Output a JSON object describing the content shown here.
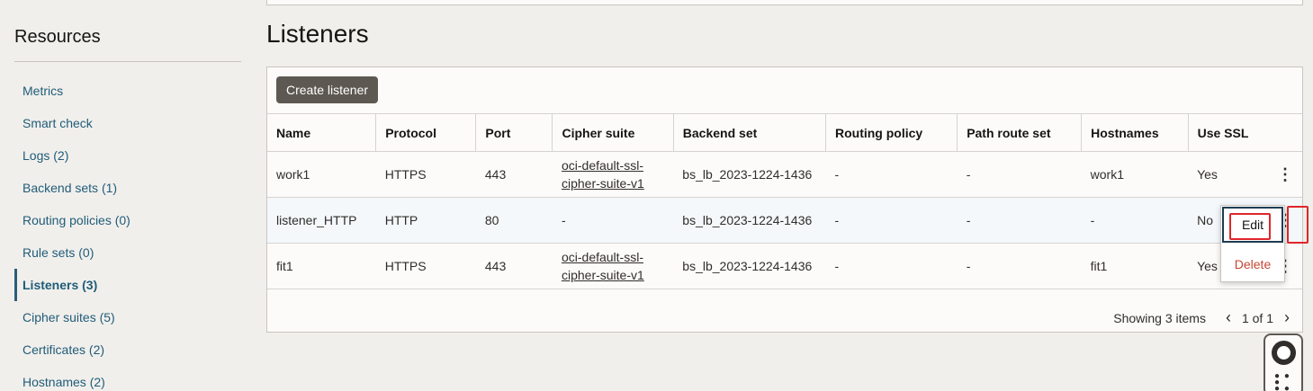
{
  "sidebar": {
    "title": "Resources",
    "items": [
      {
        "label": "Metrics",
        "active": false
      },
      {
        "label": "Smart check",
        "active": false
      },
      {
        "label": "Logs (2)",
        "active": false
      },
      {
        "label": "Backend sets (1)",
        "active": false
      },
      {
        "label": "Routing policies (0)",
        "active": false
      },
      {
        "label": "Rule sets (0)",
        "active": false
      },
      {
        "label": "Listeners (3)",
        "active": true
      },
      {
        "label": "Cipher suites (5)",
        "active": false
      },
      {
        "label": "Certificates (2)",
        "active": false
      },
      {
        "label": "Hostnames (2)",
        "active": false
      }
    ]
  },
  "main": {
    "title": "Listeners",
    "create_button": "Create listener",
    "columns": [
      "Name",
      "Protocol",
      "Port",
      "Cipher suite",
      "Backend set",
      "Routing policy",
      "Path route set",
      "Hostnames",
      "Use SSL"
    ],
    "rows": [
      {
        "name": "work1",
        "protocol": "HTTPS",
        "port": "443",
        "cipher_line1": "oci-default-ssl-",
        "cipher_line2": "cipher-suite-v1",
        "cipher_plain": "",
        "backend_set": "bs_lb_2023-1224-1436",
        "routing_policy": "-",
        "path_route_set": "-",
        "hostnames": "work1",
        "use_ssl": "Yes"
      },
      {
        "name": "listener_HTTP",
        "protocol": "HTTP",
        "port": "80",
        "cipher_line1": "",
        "cipher_line2": "",
        "cipher_plain": "-",
        "backend_set": "bs_lb_2023-1224-1436",
        "routing_policy": "-",
        "path_route_set": "-",
        "hostnames": "-",
        "use_ssl": "No"
      },
      {
        "name": "fit1",
        "protocol": "HTTPS",
        "port": "443",
        "cipher_line1": "oci-default-ssl-",
        "cipher_line2": "cipher-suite-v1",
        "cipher_plain": "",
        "backend_set": "bs_lb_2023-1224-1436",
        "routing_policy": "-",
        "path_route_set": "-",
        "hostnames": "fit1",
        "use_ssl": "Yes"
      }
    ],
    "footer": {
      "showing": "Showing 3 items",
      "page": "1 of 1"
    }
  },
  "context_menu": {
    "edit": "Edit",
    "delete": "Delete"
  },
  "icons": {
    "kebab": "kebab-menu-icon",
    "prev": "chevron-left-icon",
    "next": "chevron-right-icon",
    "help": "lifebuoy-icon"
  },
  "colors": {
    "accent_link": "#1f5c7a",
    "button_bg": "#5e5852",
    "delete_red": "#c74634",
    "highlight_red": "#e0262b"
  }
}
